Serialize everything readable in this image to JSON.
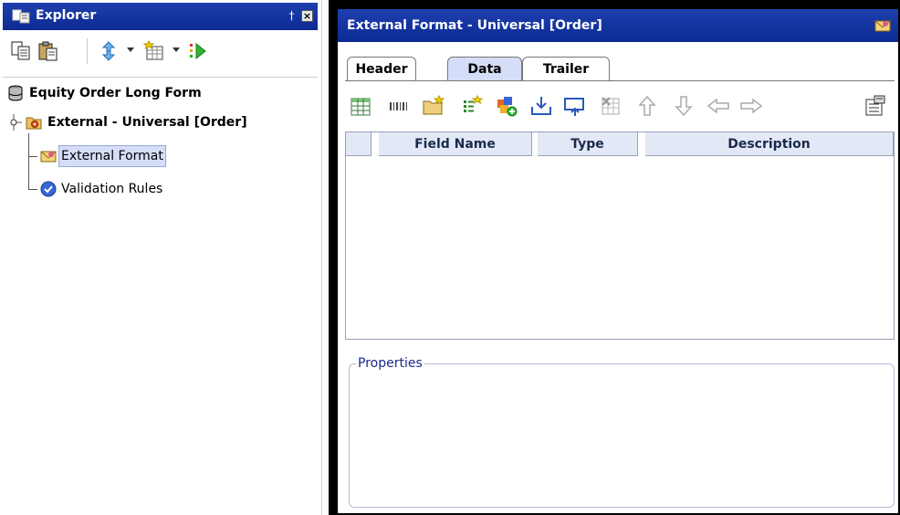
{
  "explorer": {
    "title": "Explorer",
    "pin_glyph": "†",
    "close_glyph": "×",
    "toolbar_icons": [
      "copy-icon",
      "paste-icon",
      "sort-icon",
      "grid-new-icon",
      "run-icon"
    ],
    "tree": {
      "root": {
        "label": "Equity Order Long Form",
        "icon": "database-icon"
      },
      "group": {
        "label": "External - Universal [Order]",
        "icon": "folder-gear-icon"
      },
      "children": [
        {
          "label": "External Format",
          "icon": "envelope-icon",
          "selected": true
        },
        {
          "label": "Validation Rules",
          "icon": "check-circle-icon",
          "selected": false
        }
      ]
    }
  },
  "main": {
    "title": "External Format - Universal [Order]",
    "tabs": [
      {
        "label": "Header",
        "active": false
      },
      {
        "label": "Data",
        "active": true
      },
      {
        "label": "Trailer",
        "active": false
      }
    ],
    "toolbar_icons": [
      "insert-table-icon",
      "barcode-icon",
      "new-folder-icon",
      "add-field-icon",
      "add-component-icon",
      "import-icon",
      "layout-icon",
      "delete-icon",
      "move-up-icon",
      "move-down-icon",
      "move-left-icon",
      "move-right-icon",
      "properties-icon"
    ],
    "grid": {
      "columns": [
        "",
        "Field Name",
        "Type",
        "Description"
      ],
      "rows": []
    },
    "properties_label": "Properties"
  },
  "colors": {
    "titlebar": "#0b2a92",
    "selection": "#d5ddf8",
    "grid_header": "#e3e8f6"
  }
}
